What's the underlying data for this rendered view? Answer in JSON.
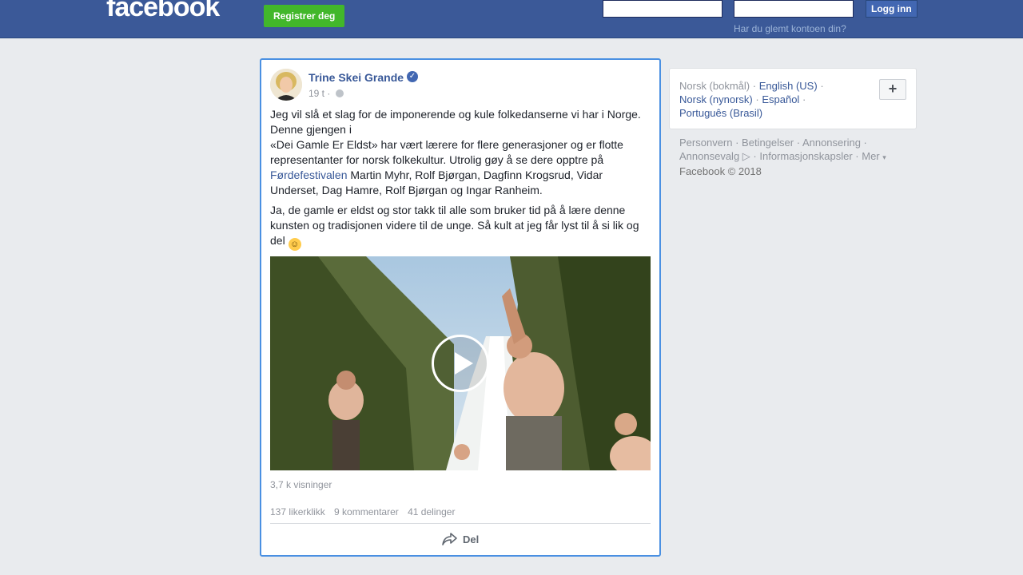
{
  "header": {
    "logo": "facebook",
    "register_label": "Registrer deg",
    "login_label": "Logg inn",
    "forgot_label": "Har du glemt kontoen din?",
    "email_value": "",
    "password_value": ""
  },
  "post": {
    "author": "Trine Skei Grande",
    "time": "19 t",
    "meta_separator": "·",
    "text_line1": "Jeg vil slå et slag for de imponerende og kule folkedanserne vi har i Norge. Denne gjengen i",
    "text_line2": "«Dei Gamle Er Eldst» har vært lærere for flere generasjoner og er flotte representanter for norsk folkekultur. Utrolig gøy å se dere opptre på",
    "text_link": "Førdefestivalen",
    "text_line3": "Martin Myhr, Rolf Bjørgan, Dagfinn Krogsrud, Vidar Underset, Dag Hamre, Rolf Bjørgan og Ingar Ranheim.",
    "text_para2": "Ja, de gamle er eldst og stor takk til alle som bruker tid på å lære denne kunsten og tradisjonen videre til de unge. Så kult at jeg får lyst til å si lik og del",
    "views": "3,7 k visninger",
    "likes": "137 likerklikk",
    "comments": "9 kommentarer",
    "shares": "41 delinger",
    "share_label": "Del"
  },
  "languages": {
    "current": "Norsk (bokmål)",
    "sep": "·",
    "options": [
      "English (US)",
      "Norsk (nynorsk)",
      "Español",
      "Português (Brasil)"
    ]
  },
  "footer": {
    "links": [
      "Personvern",
      "Betingelser",
      "Annonsering",
      "Annonsevalg",
      "Informasjonskapsler",
      "Mer"
    ],
    "copyright": "Facebook © 2018"
  },
  "colors": {
    "brand": "#3b5998",
    "register_green": "#42b72a",
    "link": "#385898",
    "focus_border": "#4a90e2"
  }
}
